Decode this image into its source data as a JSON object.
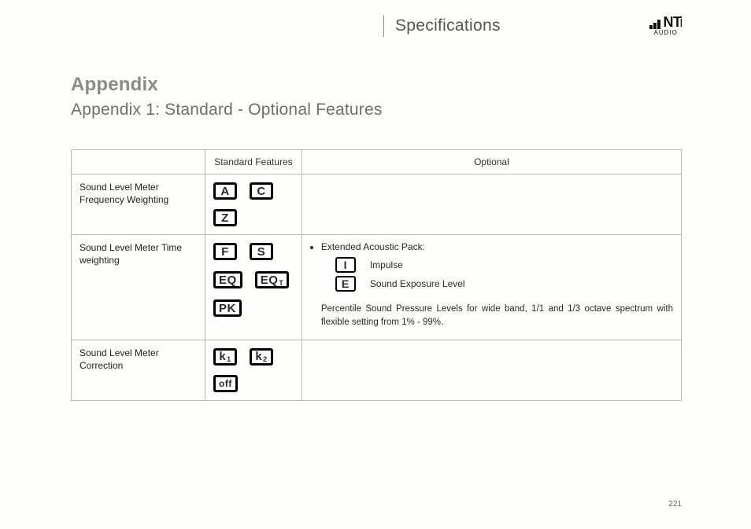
{
  "header": {
    "title": "Specifications"
  },
  "logo": {
    "text": "NTi",
    "sub": "AUDIO"
  },
  "page": {
    "heading": "Appendix",
    "subheading": "Appendix 1: Standard - Optional Features",
    "number": "221"
  },
  "table": {
    "headers": {
      "col1": "",
      "col2": "Standard Features",
      "col3": "Optional"
    },
    "rows": [
      {
        "label": "Sound Level Meter Frequency Weighting",
        "std_icons": [
          "A",
          "C",
          "Z"
        ],
        "optional": null
      },
      {
        "label": "Sound Level Meter Time weighting",
        "std_icons_rows": [
          [
            "F",
            "S"
          ],
          [
            {
              "t": "EQ"
            },
            {
              "t": "EQ",
              "sub": "T"
            }
          ],
          [
            "PK"
          ]
        ],
        "optional": {
          "title": "Extended Acoustic Pack:",
          "items": [
            {
              "icon": "I",
              "text": "Impulse"
            },
            {
              "icon": "E",
              "text": "Sound Exposure Level"
            }
          ],
          "paragraph": "Percentile Sound Pressure Levels for wide band, 1/1 and 1/3 octave spectrum with flexible setting from 1% - 99%."
        }
      },
      {
        "label": "Sound Level Meter Correction",
        "std_icons_spec": [
          {
            "t": "k",
            "sub": "1"
          },
          {
            "t": "k",
            "sub": "2"
          },
          {
            "t": "off",
            "low": true
          }
        ],
        "optional": null
      }
    ]
  }
}
